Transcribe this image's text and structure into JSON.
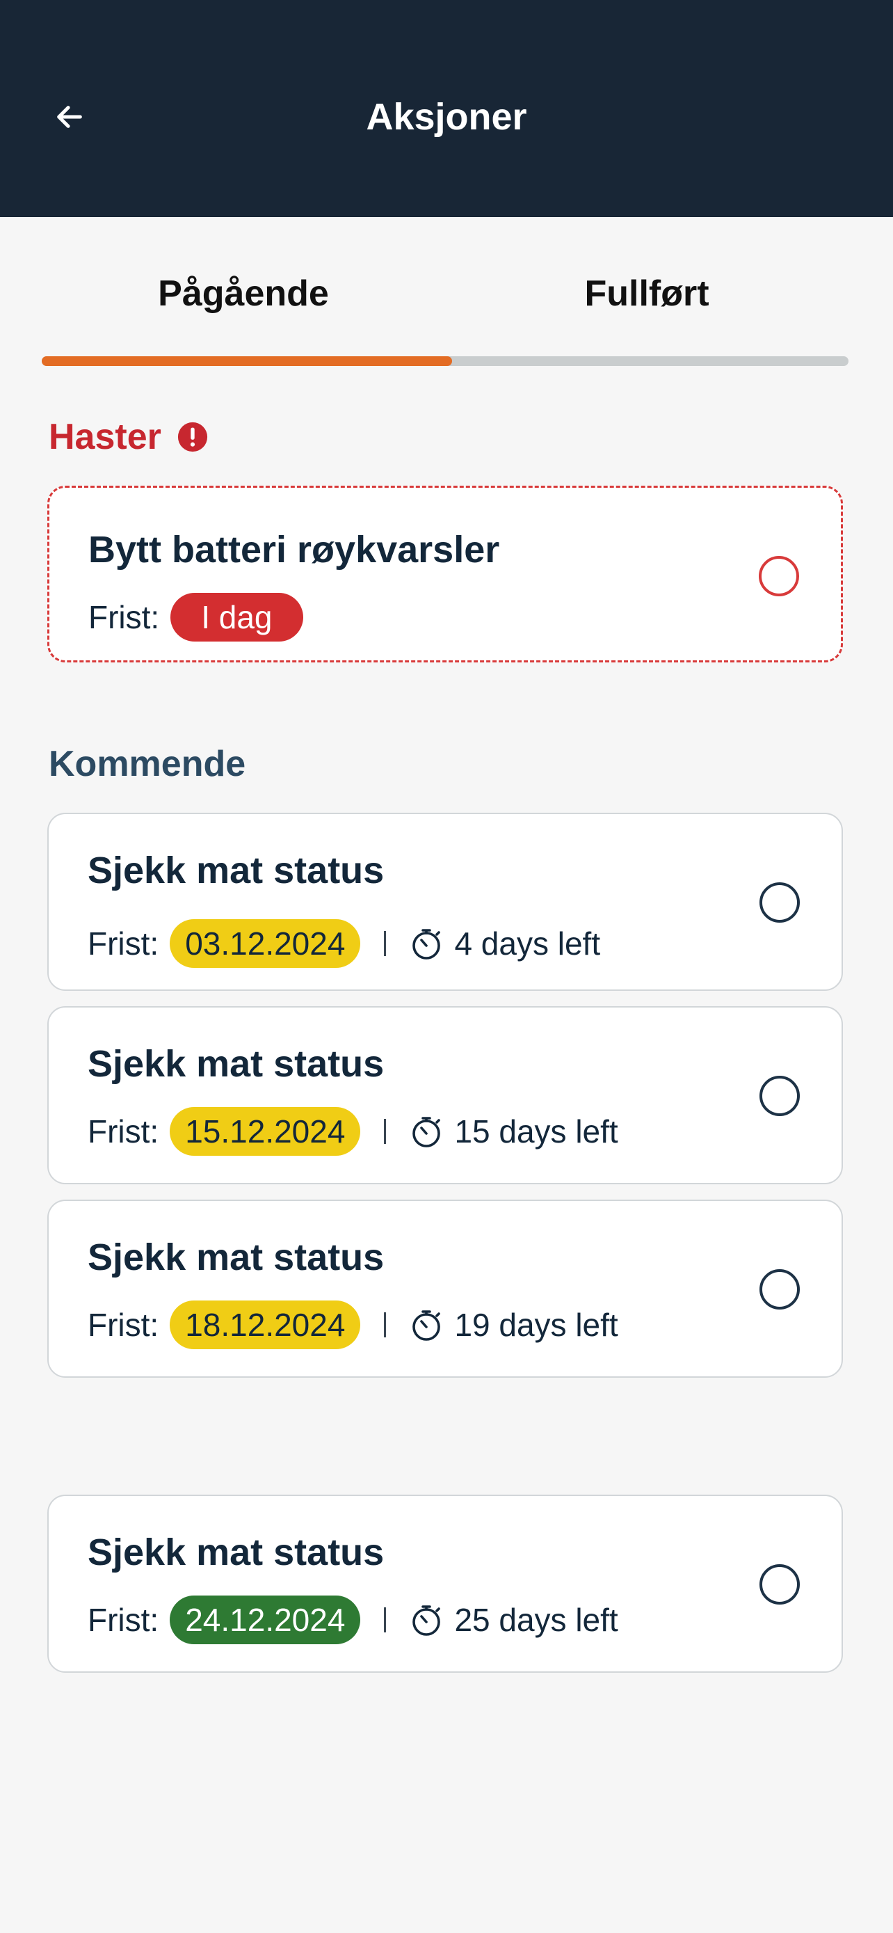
{
  "appbar": {
    "title": "Aksjoner",
    "back_icon": "arrow-left-icon"
  },
  "tabs": [
    {
      "label": "Pågående",
      "active": true
    },
    {
      "label": "Fullført",
      "active": false
    }
  ],
  "colors": {
    "appbar_bg": "#182636",
    "tab_indicator": "#e36c24",
    "urgent": "#c7272f",
    "badge_yellow": "#f0cd15",
    "badge_green": "#2e7a33",
    "badge_red": "#d32e30"
  },
  "urgent": {
    "section_title": "Haster",
    "icon": "alert-icon",
    "items": [
      {
        "title": "Bytt batteri røykvarsler",
        "deadline_label": "Frist:",
        "deadline": "I dag",
        "status": "red"
      }
    ]
  },
  "upcoming": {
    "section_title": "Kommende",
    "items": [
      {
        "title": "Sjekk mat status",
        "deadline_label": "Frist:",
        "deadline": "03.12.2024",
        "days_left": "4 days left",
        "status": "yellow"
      },
      {
        "title": "Sjekk mat status",
        "deadline_label": "Frist:",
        "deadline": "15.12.2024",
        "days_left": "15 days left",
        "status": "yellow"
      },
      {
        "title": "Sjekk mat status",
        "deadline_label": "Frist:",
        "deadline": "18.12.2024",
        "days_left": "19 days left",
        "status": "yellow"
      },
      {
        "title": "Sjekk mat status",
        "deadline_label": "Frist:",
        "deadline": "24.12.2024",
        "days_left": "25 days left",
        "status": "green"
      }
    ]
  }
}
